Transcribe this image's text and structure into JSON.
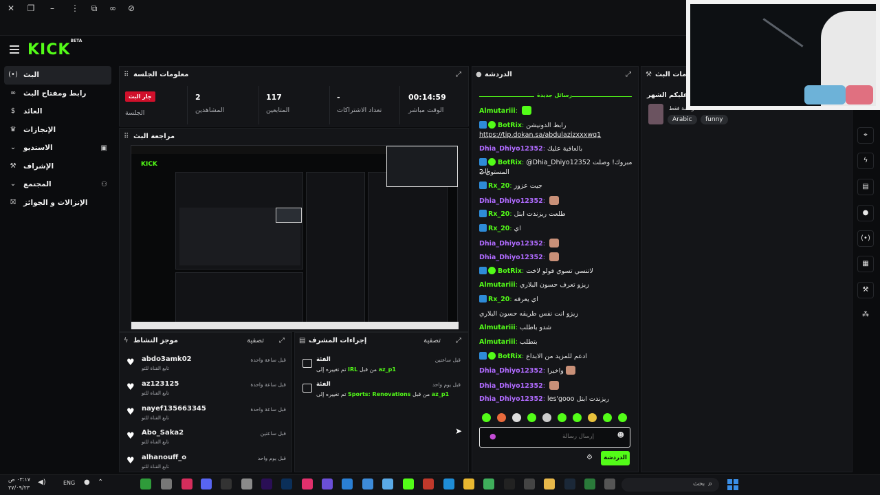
{
  "sidebar": {
    "items": [
      {
        "label": "البث",
        "icon": "live-icon"
      },
      {
        "label": "رابط ومفتاح البث",
        "icon": "link-icon"
      },
      {
        "label": "العائد",
        "icon": "dollar-icon"
      },
      {
        "label": "الإنجازات",
        "icon": "trophy-icon"
      },
      {
        "label": "الاستديو",
        "icon": "chevron-down-icon"
      },
      {
        "label": "الإشراف",
        "icon": "wrench-icon"
      },
      {
        "label": "المجتمع",
        "icon": "chevron-down-icon"
      },
      {
        "label": "الإنزالات و الجوائز",
        "icon": "gift-icon"
      }
    ]
  },
  "session": {
    "title": "معلومات الجلسة",
    "live_badge": "جار البث",
    "stats": [
      {
        "label": "الجلسة",
        "value": ""
      },
      {
        "label": "المشاهدين",
        "value": "2"
      },
      {
        "label": "المتابعين",
        "value": "117"
      },
      {
        "label": "تعداد الاشتراكات",
        "value": "-"
      },
      {
        "label": "الوقت مباشر",
        "value": "00:14:59"
      }
    ]
  },
  "preview": {
    "title": "مراجعة البث"
  },
  "activity": {
    "title": "موجز النشاط",
    "filter": "تصفية",
    "items": [
      {
        "name": "abdo3amk02",
        "sub": "تابع القناة للتو",
        "time": "قبل ساعة واحدة"
      },
      {
        "name": "az123125",
        "sub": "تابع القناة للتو",
        "time": "قبل ساعة واحدة"
      },
      {
        "name": "nayef135663345",
        "sub": "تابع القناة للتو",
        "time": "قبل ساعة واحدة"
      },
      {
        "name": "Abo_Saka2",
        "sub": "تابع القناة للتو",
        "time": "قبل ساعتين"
      },
      {
        "name": "alhanouff_o",
        "sub": "تابع القناة للتو",
        "time": "قبل يوم واحد"
      }
    ]
  },
  "mod": {
    "title": "إجراءات المشرف",
    "filter": "تصفية",
    "items": [
      {
        "title": "الفئة",
        "pre": "تم تغييره إلى",
        "cat": "IRL",
        "mid": "من قبل",
        "user": "az_p1",
        "time": "قبل ساعتين"
      },
      {
        "title": "الفئة",
        "pre": "تم تغييره إلى",
        "cat": "Sports: Renovations",
        "mid": "من قبل",
        "user": "az_p1",
        "time": "قبل يوم واحد"
      }
    ]
  },
  "chat": {
    "title": "الدردشة",
    "new_messages": "رسائل جديدة",
    "messages": [
      {
        "user": "Almutariii",
        "color": "#53fc18",
        "text": "",
        "badges": [],
        "emote": true
      },
      {
        "user": "BotRix",
        "color": "#53fc18",
        "text": "رابط الدونيشن",
        "badges": [
          "bot",
          "verified"
        ],
        "emote": false
      },
      {
        "user": "",
        "color": "#53fc18",
        "text": "https://tip.dokan.sa/abdulazizxxxwq1",
        "badges": [],
        "emote": false,
        "link": true
      },
      {
        "user": "Dhia_Dhiyo12352",
        "color": "#b06bff",
        "text": "بالعافية عليك",
        "badges": [],
        "emote": false
      },
      {
        "user": "BotRix",
        "color": "#53fc18",
        "text": "@Dhia_Dhiyo12352 مبروك! وصلت إلى",
        "badges": [
          "bot",
          "verified"
        ],
        "emote": false
      },
      {
        "user": "",
        "color": "#53fc18",
        "text": "المستوى 2",
        "badges": [],
        "emote": false
      },
      {
        "user": "Rx_20",
        "color": "#53fc18",
        "text": "جيت عزوز",
        "badges": [
          "bot"
        ],
        "emote": false
      },
      {
        "user": "Dhia_Dhiyo12352",
        "color": "#b06bff",
        "text": "",
        "badges": [],
        "emote": true
      },
      {
        "user": "Rx_20",
        "color": "#53fc18",
        "text": "طلعت ريزندت ابتل",
        "badges": [
          "bot"
        ],
        "emote": false
      },
      {
        "user": "Rx_20",
        "color": "#53fc18",
        "text": "اي",
        "badges": [
          "bot"
        ],
        "emote": false
      },
      {
        "user": "Dhia_Dhiyo12352",
        "color": "#b06bff",
        "text": "",
        "badges": [],
        "emote": true
      },
      {
        "user": "Dhia_Dhiyo12352",
        "color": "#b06bff",
        "text": "",
        "badges": [],
        "emote": true
      },
      {
        "user": "BotRix",
        "color": "#53fc18",
        "text": "لاتنسي تسوي فولو لاخت",
        "badges": [
          "bot",
          "verified"
        ],
        "emote": false
      },
      {
        "user": "Almutariii",
        "color": "#53fc18",
        "text": "زيزو تعرف حسون البلاري",
        "badges": [],
        "emote": false
      },
      {
        "user": "Rx_20",
        "color": "#53fc18",
        "text": "اي يعرفه",
        "badges": [
          "bot"
        ],
        "emote": false
      },
      {
        "user": "",
        "color": "#53fc18",
        "text": "زيزو انت نفس طريقه حسون البلاري",
        "badges": [],
        "emote": false
      },
      {
        "user": "Almutariii",
        "color": "#53fc18",
        "text": "شدو باطلب",
        "badges": [],
        "emote": false
      },
      {
        "user": "Almutariii",
        "color": "#53fc18",
        "text": "بتطلب",
        "badges": [],
        "emote": false
      },
      {
        "user": "BotRix",
        "color": "#53fc18",
        "text": "ادعم للمزيد من الابداع",
        "badges": [
          "bot",
          "verified"
        ],
        "emote": false
      },
      {
        "user": "Dhia_Dhiyo12352",
        "color": "#b06bff",
        "text": "واخيرا",
        "badges": [],
        "emote": true
      },
      {
        "user": "Dhia_Dhiyo12352",
        "color": "#b06bff",
        "text": "",
        "badges": [],
        "emote": true
      },
      {
        "user": "Dhia_Dhiyo12352",
        "color": "#b06bff",
        "text": "les'gooo ريزندت ابتل",
        "badges": [],
        "emote": false
      }
    ],
    "input_placeholder": "إرسال رسالة",
    "send_label": "الدردشة"
  },
  "stream_info": {
    "title": "معلومات البث",
    "greeting": "مبارك عليكم الشهر",
    "subtitle": "دردشة فقط",
    "tags": [
      "Arabic",
      "funny"
    ]
  },
  "taskbar": {
    "lang": "ENG",
    "time": "٠٣:١٧ ص",
    "date": "٢٧/٠٩/٢٣",
    "search": "بحث"
  },
  "colors": {
    "accent": "#53fc18",
    "live": "#d0102b",
    "purple": "#b06bff"
  }
}
